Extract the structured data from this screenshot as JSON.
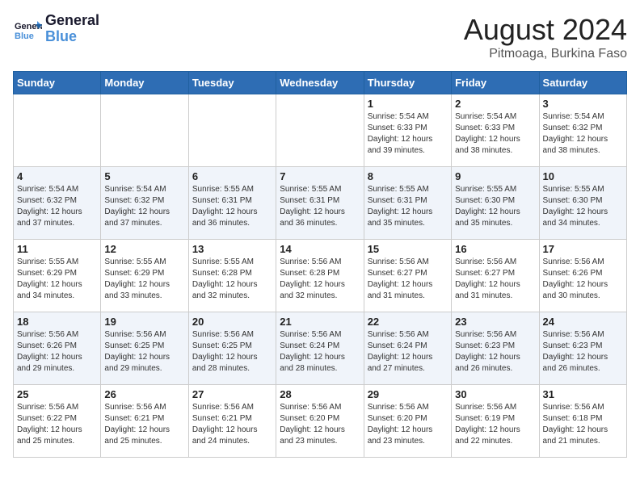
{
  "header": {
    "logo_general": "General",
    "logo_blue": "Blue",
    "title": "August 2024",
    "subtitle": "Pitmoaga, Burkina Faso"
  },
  "weekdays": [
    "Sunday",
    "Monday",
    "Tuesday",
    "Wednesday",
    "Thursday",
    "Friday",
    "Saturday"
  ],
  "weeks": [
    [
      {
        "day": "",
        "info": ""
      },
      {
        "day": "",
        "info": ""
      },
      {
        "day": "",
        "info": ""
      },
      {
        "day": "",
        "info": ""
      },
      {
        "day": "1",
        "info": "Sunrise: 5:54 AM\nSunset: 6:33 PM\nDaylight: 12 hours\nand 39 minutes."
      },
      {
        "day": "2",
        "info": "Sunrise: 5:54 AM\nSunset: 6:33 PM\nDaylight: 12 hours\nand 38 minutes."
      },
      {
        "day": "3",
        "info": "Sunrise: 5:54 AM\nSunset: 6:32 PM\nDaylight: 12 hours\nand 38 minutes."
      }
    ],
    [
      {
        "day": "4",
        "info": "Sunrise: 5:54 AM\nSunset: 6:32 PM\nDaylight: 12 hours\nand 37 minutes."
      },
      {
        "day": "5",
        "info": "Sunrise: 5:54 AM\nSunset: 6:32 PM\nDaylight: 12 hours\nand 37 minutes."
      },
      {
        "day": "6",
        "info": "Sunrise: 5:55 AM\nSunset: 6:31 PM\nDaylight: 12 hours\nand 36 minutes."
      },
      {
        "day": "7",
        "info": "Sunrise: 5:55 AM\nSunset: 6:31 PM\nDaylight: 12 hours\nand 36 minutes."
      },
      {
        "day": "8",
        "info": "Sunrise: 5:55 AM\nSunset: 6:31 PM\nDaylight: 12 hours\nand 35 minutes."
      },
      {
        "day": "9",
        "info": "Sunrise: 5:55 AM\nSunset: 6:30 PM\nDaylight: 12 hours\nand 35 minutes."
      },
      {
        "day": "10",
        "info": "Sunrise: 5:55 AM\nSunset: 6:30 PM\nDaylight: 12 hours\nand 34 minutes."
      }
    ],
    [
      {
        "day": "11",
        "info": "Sunrise: 5:55 AM\nSunset: 6:29 PM\nDaylight: 12 hours\nand 34 minutes."
      },
      {
        "day": "12",
        "info": "Sunrise: 5:55 AM\nSunset: 6:29 PM\nDaylight: 12 hours\nand 33 minutes."
      },
      {
        "day": "13",
        "info": "Sunrise: 5:55 AM\nSunset: 6:28 PM\nDaylight: 12 hours\nand 32 minutes."
      },
      {
        "day": "14",
        "info": "Sunrise: 5:56 AM\nSunset: 6:28 PM\nDaylight: 12 hours\nand 32 minutes."
      },
      {
        "day": "15",
        "info": "Sunrise: 5:56 AM\nSunset: 6:27 PM\nDaylight: 12 hours\nand 31 minutes."
      },
      {
        "day": "16",
        "info": "Sunrise: 5:56 AM\nSunset: 6:27 PM\nDaylight: 12 hours\nand 31 minutes."
      },
      {
        "day": "17",
        "info": "Sunrise: 5:56 AM\nSunset: 6:26 PM\nDaylight: 12 hours\nand 30 minutes."
      }
    ],
    [
      {
        "day": "18",
        "info": "Sunrise: 5:56 AM\nSunset: 6:26 PM\nDaylight: 12 hours\nand 29 minutes."
      },
      {
        "day": "19",
        "info": "Sunrise: 5:56 AM\nSunset: 6:25 PM\nDaylight: 12 hours\nand 29 minutes."
      },
      {
        "day": "20",
        "info": "Sunrise: 5:56 AM\nSunset: 6:25 PM\nDaylight: 12 hours\nand 28 minutes."
      },
      {
        "day": "21",
        "info": "Sunrise: 5:56 AM\nSunset: 6:24 PM\nDaylight: 12 hours\nand 28 minutes."
      },
      {
        "day": "22",
        "info": "Sunrise: 5:56 AM\nSunset: 6:24 PM\nDaylight: 12 hours\nand 27 minutes."
      },
      {
        "day": "23",
        "info": "Sunrise: 5:56 AM\nSunset: 6:23 PM\nDaylight: 12 hours\nand 26 minutes."
      },
      {
        "day": "24",
        "info": "Sunrise: 5:56 AM\nSunset: 6:23 PM\nDaylight: 12 hours\nand 26 minutes."
      }
    ],
    [
      {
        "day": "25",
        "info": "Sunrise: 5:56 AM\nSunset: 6:22 PM\nDaylight: 12 hours\nand 25 minutes."
      },
      {
        "day": "26",
        "info": "Sunrise: 5:56 AM\nSunset: 6:21 PM\nDaylight: 12 hours\nand 25 minutes."
      },
      {
        "day": "27",
        "info": "Sunrise: 5:56 AM\nSunset: 6:21 PM\nDaylight: 12 hours\nand 24 minutes."
      },
      {
        "day": "28",
        "info": "Sunrise: 5:56 AM\nSunset: 6:20 PM\nDaylight: 12 hours\nand 23 minutes."
      },
      {
        "day": "29",
        "info": "Sunrise: 5:56 AM\nSunset: 6:20 PM\nDaylight: 12 hours\nand 23 minutes."
      },
      {
        "day": "30",
        "info": "Sunrise: 5:56 AM\nSunset: 6:19 PM\nDaylight: 12 hours\nand 22 minutes."
      },
      {
        "day": "31",
        "info": "Sunrise: 5:56 AM\nSunset: 6:18 PM\nDaylight: 12 hours\nand 21 minutes."
      }
    ]
  ]
}
